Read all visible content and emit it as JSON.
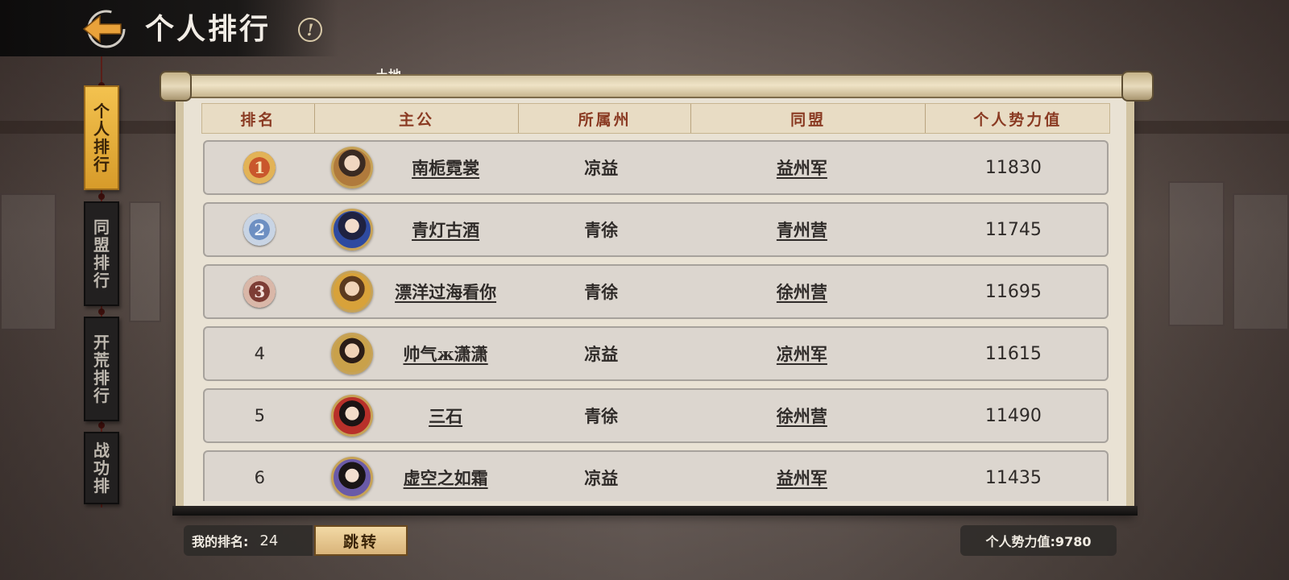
{
  "header": {
    "title": "个人排行",
    "info_icon": "info-icon",
    "back_icon": "back-arrow-icon"
  },
  "behind_text": "土地",
  "side_tabs": [
    {
      "label_chars": [
        "个",
        "人",
        "排",
        "行"
      ],
      "active": true
    },
    {
      "label_chars": [
        "同",
        "盟",
        "排",
        "行"
      ],
      "active": false
    },
    {
      "label_chars": [
        "开",
        "荒",
        "排",
        "行"
      ],
      "active": false
    },
    {
      "label_chars": [
        "战",
        "功",
        "排"
      ],
      "active": false
    }
  ],
  "table": {
    "columns": [
      "排名",
      "主公",
      "所属州",
      "同盟",
      "个人势力值"
    ],
    "rows": [
      {
        "rank": "1",
        "name": "南栀霓裳",
        "state": "凉益",
        "alliance": "益州军",
        "power": "11830"
      },
      {
        "rank": "2",
        "name": "青灯古酒",
        "state": "青徐",
        "alliance": "青州营",
        "power": "11745"
      },
      {
        "rank": "3",
        "name": "漂洋过海看你",
        "state": "青徐",
        "alliance": "徐州营",
        "power": "11695"
      },
      {
        "rank": "4",
        "name": "帅气ж潇潇",
        "state": "凉益",
        "alliance": "凉州军",
        "power": "11615"
      },
      {
        "rank": "5",
        "name": "三石",
        "state": "青徐",
        "alliance": "徐州营",
        "power": "11490"
      },
      {
        "rank": "6",
        "name": "虚空之如霜",
        "state": "凉益",
        "alliance": "益州军",
        "power": "11435"
      }
    ]
  },
  "footer": {
    "my_rank_label": "我的排名:",
    "my_rank_value": "24",
    "jump_label": "跳转",
    "my_power_text": "个人势力值:9780"
  },
  "colors": {
    "header_text": "#8a3a22",
    "active_tab": "#f3c24f",
    "row_bg": "#dcd6cf"
  }
}
